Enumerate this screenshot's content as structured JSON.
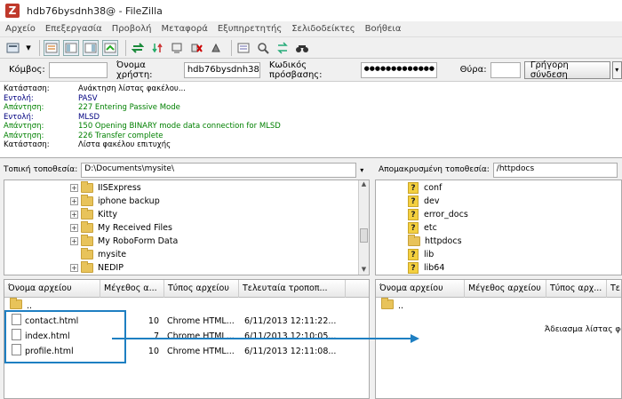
{
  "window": {
    "title": "hdb76bysdnh38@            - FileZilla",
    "app_icon": "Z"
  },
  "menu": [
    "Αρχείο",
    "Επεξεργασία",
    "Προβολή",
    "Μεταφορά",
    "Εξυπηρετητής",
    "Σελιδοδείκτες",
    "Βοήθεια"
  ],
  "toolbar_icons": [
    "site-manager-icon",
    "dropdown-icon",
    "toggle-log-icon",
    "toggle-local-tree-icon",
    "toggle-remote-tree-icon",
    "toggle-queue-icon",
    "refresh-icon",
    "process-queue-icon",
    "cancel-icon",
    "disconnect-icon",
    "reconnect-icon",
    "filter-icon",
    "compare-icon",
    "sync-browse-icon",
    "search-icon"
  ],
  "quickconnect": {
    "host_label": "Κόμβος:",
    "host_value": "",
    "user_label": "Όνομα χρήστη:",
    "user_value": "hdb76bysdnh38",
    "pass_label": "Κωδικός πρόσβασης:",
    "pass_value": "●●●●●●●●●●●●●",
    "port_label": "Θύρα:",
    "port_value": "",
    "connect_button": "Γρήγορη σύνδεση",
    "dropdown": "▾"
  },
  "log": [
    {
      "type": "status",
      "key": "Κατάσταση:",
      "value": "Ανάκτηση λίστας φακέλου..."
    },
    {
      "type": "cmd",
      "key": "Εντολή:",
      "value": "PASV"
    },
    {
      "type": "resp",
      "key": "Απάντηση:",
      "value": "227 Entering Passive Mode"
    },
    {
      "type": "cmd",
      "key": "Εντολή:",
      "value": "MLSD"
    },
    {
      "type": "resp",
      "key": "Απάντηση:",
      "value": "150 Opening BINARY mode data connection for MLSD"
    },
    {
      "type": "resp",
      "key": "Απάντηση:",
      "value": "226 Transfer complete"
    },
    {
      "type": "status",
      "key": "Κατάσταση:",
      "value": "Λίστα φακέλου επιτυχής"
    }
  ],
  "local": {
    "path_label": "Τοπική τοποθεσία:",
    "path_value": "D:\\Documents\\mysite\\",
    "tree": [
      {
        "label": "IISExpress",
        "expandable": true
      },
      {
        "label": "iphone backup",
        "expandable": true
      },
      {
        "label": "Kitty",
        "expandable": true
      },
      {
        "label": "My Received Files",
        "expandable": true
      },
      {
        "label": "My RoboForm Data",
        "expandable": true
      },
      {
        "label": "mysite",
        "expandable": false
      },
      {
        "label": "NEDIP",
        "expandable": false
      }
    ],
    "columns": [
      "Όνομα αρχείου",
      "Μέγεθος α...",
      "Τύπος αρχείου",
      "Τελευταία τροποπ..."
    ],
    "parent_row": "..",
    "files": [
      {
        "name": "contact.html",
        "size": "10",
        "type": "Chrome HTML...",
        "modified": "6/11/2013 12:11:22..."
      },
      {
        "name": "index.html",
        "size": "7",
        "type": "Chrome HTML...",
        "modified": "6/11/2013 12:10:05..."
      },
      {
        "name": "profile.html",
        "size": "10",
        "type": "Chrome HTML...",
        "modified": "6/11/2013 12:11:08..."
      }
    ]
  },
  "remote": {
    "path_label": "Απομακρυσμένη τοποθεσία:",
    "path_value": "/httpdocs",
    "tree": [
      {
        "label": "conf",
        "known": false
      },
      {
        "label": "dev",
        "known": false
      },
      {
        "label": "error_docs",
        "known": false
      },
      {
        "label": "etc",
        "known": false
      },
      {
        "label": "httpdocs",
        "known": true
      },
      {
        "label": "lib",
        "known": false
      },
      {
        "label": "lib64",
        "known": false
      }
    ],
    "columns": [
      "Όνομα αρχείου",
      "Μέγεθος αρχείου",
      "Τύπος αρχ...",
      "Τε"
    ],
    "parent_row": "..",
    "empty_message": "Άδειασμα λίστας φα"
  },
  "colors": {
    "highlight": "#1e7fc2",
    "command": "#000080",
    "response": "#008000"
  }
}
